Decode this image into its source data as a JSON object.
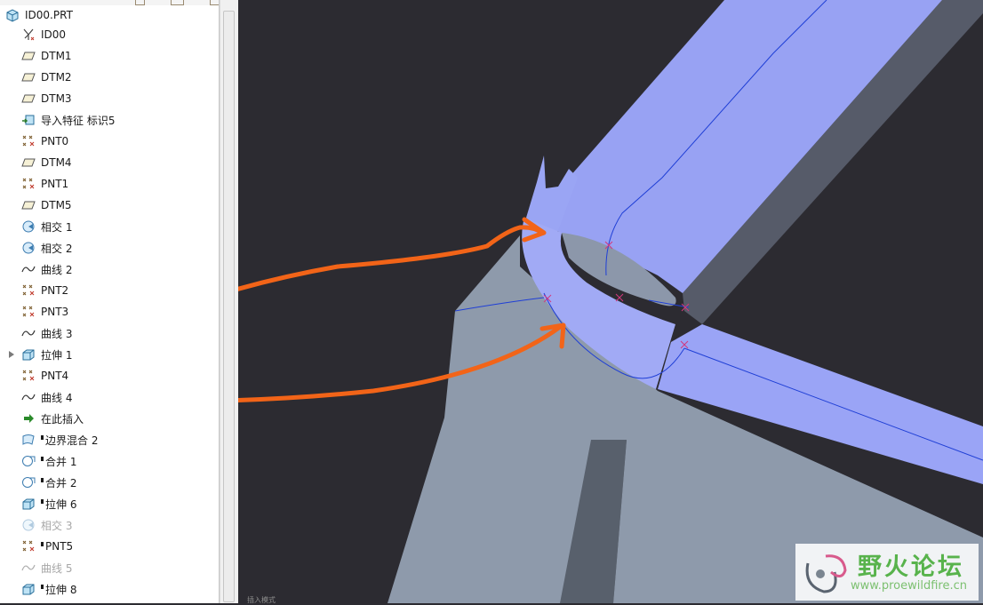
{
  "model_tree": {
    "root": {
      "label": "ID00.PRT",
      "icon": "part-icon"
    },
    "items": [
      {
        "label": "ID00",
        "icon": "csys-icon",
        "state": "normal"
      },
      {
        "label": "DTM1",
        "icon": "datum-plane-icon",
        "state": "normal"
      },
      {
        "label": "DTM2",
        "icon": "datum-plane-icon",
        "state": "normal"
      },
      {
        "label": "DTM3",
        "icon": "datum-plane-icon",
        "state": "normal"
      },
      {
        "label": "导入特征 标识5",
        "icon": "import-feature-icon",
        "state": "normal"
      },
      {
        "label": "PNT0",
        "icon": "datum-point-icon",
        "state": "normal"
      },
      {
        "label": "DTM4",
        "icon": "datum-plane-icon",
        "state": "normal"
      },
      {
        "label": "PNT1",
        "icon": "datum-point-icon",
        "state": "normal"
      },
      {
        "label": "DTM5",
        "icon": "datum-plane-icon",
        "state": "normal"
      },
      {
        "label": "相交 1",
        "icon": "intersect-icon",
        "state": "normal"
      },
      {
        "label": "相交 2",
        "icon": "intersect-icon",
        "state": "normal"
      },
      {
        "label": "曲线 2",
        "icon": "curve-icon",
        "state": "normal"
      },
      {
        "label": "PNT2",
        "icon": "datum-point-icon",
        "state": "normal"
      },
      {
        "label": "PNT3",
        "icon": "datum-point-icon",
        "state": "normal"
      },
      {
        "label": "曲线 3",
        "icon": "curve-icon",
        "state": "normal"
      },
      {
        "label": "拉伸 1",
        "icon": "extrude-icon",
        "state": "normal"
      },
      {
        "label": "PNT4",
        "icon": "datum-point-icon",
        "state": "normal"
      },
      {
        "label": "曲线 4",
        "icon": "curve-icon",
        "state": "normal"
      },
      {
        "label": "在此插入",
        "icon": "insert-here-arrow-icon",
        "state": "normal"
      },
      {
        "label": "边界混合 2",
        "icon": "boundary-blend-icon",
        "state": "flagged"
      },
      {
        "label": "合并 1",
        "icon": "merge-icon",
        "state": "flagged"
      },
      {
        "label": "合并 2",
        "icon": "merge-icon",
        "state": "flagged"
      },
      {
        "label": "拉伸 6",
        "icon": "extrude-icon",
        "state": "flagged"
      },
      {
        "label": "相交 3",
        "icon": "intersect-icon",
        "state": "disabled"
      },
      {
        "label": "PNT5",
        "icon": "datum-point-icon",
        "state": "flagged"
      },
      {
        "label": "曲线 5",
        "icon": "curve-icon",
        "state": "disabled"
      },
      {
        "label": "拉伸 8",
        "icon": "extrude-icon",
        "state": "flagged"
      }
    ]
  },
  "status_bar": {
    "text": "插入模式"
  },
  "watermark": {
    "title": "野火论坛",
    "url": "www.proewildfire.cn"
  },
  "colors": {
    "viewport_bg": "#2c2b31",
    "surface_highlight": "#9ba5f5",
    "solid_gray": "#8e9aab",
    "annotation_arrow": "#f26418",
    "edge_line": "#1f3fd6"
  }
}
